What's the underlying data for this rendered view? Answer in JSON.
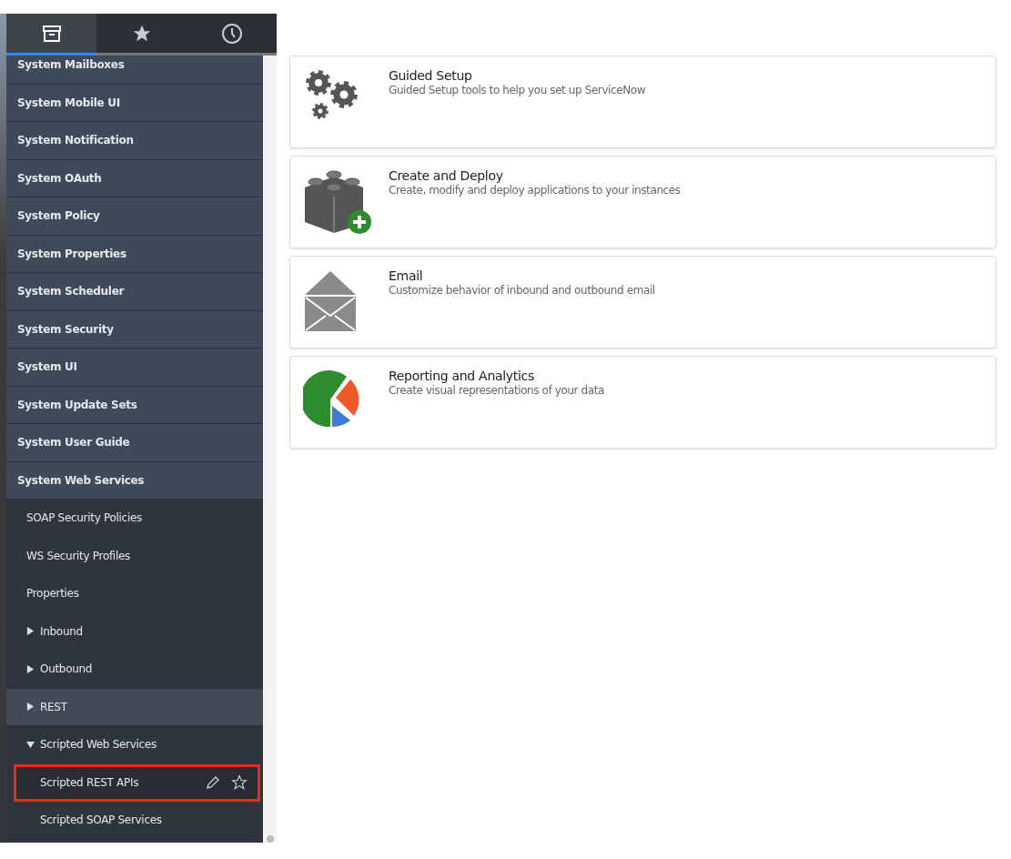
{
  "tabs": [
    {
      "kind": "archive",
      "selected": true
    },
    {
      "kind": "star",
      "selected": false
    },
    {
      "kind": "clock",
      "selected": false
    }
  ],
  "nav": [
    {
      "label": "System Mailboxes"
    },
    {
      "label": "System Mobile UI"
    },
    {
      "label": "System Notification"
    },
    {
      "label": "System OAuth"
    },
    {
      "label": "System Policy"
    },
    {
      "label": "System Properties"
    },
    {
      "label": "System Scheduler"
    },
    {
      "label": "System Security"
    },
    {
      "label": "System UI"
    },
    {
      "label": "System Update Sets"
    },
    {
      "label": "System User Guide"
    },
    {
      "label": "System Web Services",
      "children": [
        {
          "label": "SOAP Security Policies",
          "highlighted": false
        },
        {
          "label": "WS Security Profiles",
          "highlighted": false
        },
        {
          "label": "Properties",
          "highlighted": false
        },
        {
          "label": "Inbound",
          "expanded": false,
          "highlighted": false
        },
        {
          "label": "Outbound",
          "expanded": false,
          "highlighted": false
        },
        {
          "label": "REST",
          "expanded": false,
          "highlighted": true
        },
        {
          "label": "Scripted Web Services",
          "expanded": true,
          "highlighted": false,
          "children": [
            {
              "label": "Scripted REST APIs",
              "outlined": true,
              "actions": true
            },
            {
              "label": "Scripted SOAP Services",
              "outlined": false,
              "actions": false
            }
          ]
        }
      ]
    }
  ],
  "cards": [
    {
      "kind": "gears",
      "title": "Guided Setup",
      "description": "Guided Setup tools to help you set up ServiceNow"
    },
    {
      "kind": "blocks",
      "title": "Create and Deploy",
      "description": "Create, modify and deploy applications to your instances"
    },
    {
      "kind": "envelope",
      "title": "Email",
      "description": "Customize behavior of inbound and outbound email"
    },
    {
      "kind": "pie",
      "title": "Reporting and Analytics",
      "description": "Create visual representations of your data"
    }
  ]
}
